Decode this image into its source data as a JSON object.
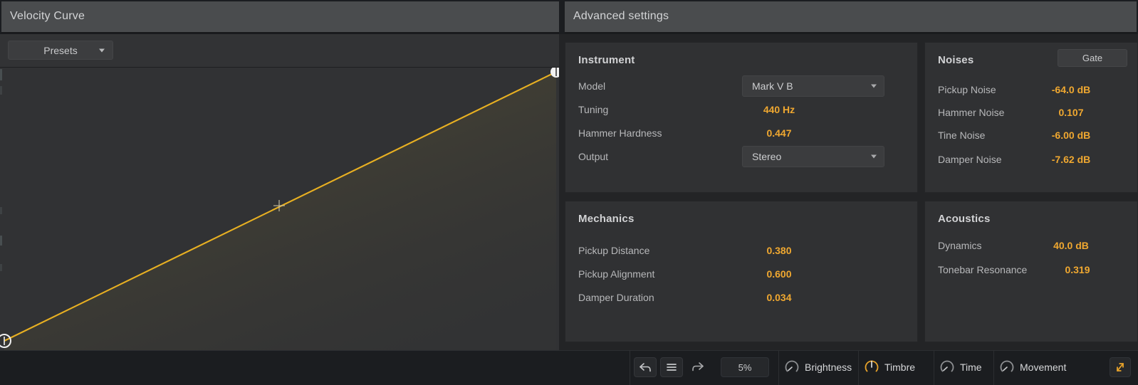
{
  "header": {
    "left_title": "Velocity Curve",
    "right_title": "Advanced settings"
  },
  "velocity_curve": {
    "presets_label": "Presets",
    "presets_caret_icon": "chevron-down-icon",
    "curve_color": "#e8b022",
    "fill_color": "#554c2e",
    "background": "#313234",
    "chart_data": {
      "type": "line",
      "title": "Velocity Curve",
      "xlabel": "",
      "ylabel": "",
      "xlim": [
        0,
        1
      ],
      "ylim": [
        0,
        1
      ],
      "grid": false,
      "series": [
        {
          "name": "velocity",
          "points": [
            [
              0,
              0
            ],
            [
              0.5,
              0.5
            ],
            [
              1,
              1
            ]
          ]
        }
      ],
      "handles": [
        {
          "name": "start-handle",
          "x": 0,
          "y": 0
        },
        {
          "name": "mid-handle",
          "x": 0.5,
          "y": 0.5
        },
        {
          "name": "end-handle",
          "x": 1,
          "y": 1
        }
      ]
    }
  },
  "advanced": {
    "instrument": {
      "title": "Instrument",
      "rows": [
        {
          "label": "Model",
          "value": "Mark V B",
          "type": "select"
        },
        {
          "label": "Tuning",
          "value": "440 Hz",
          "type": "value"
        },
        {
          "label": "Hammer Hardness",
          "value": "0.447",
          "type": "value"
        },
        {
          "label": "Output",
          "value": "Stereo",
          "type": "select"
        }
      ]
    },
    "mechanics": {
      "title": "Mechanics",
      "rows": [
        {
          "label": "Pickup Distance",
          "value": "0.380"
        },
        {
          "label": "Pickup Alignment",
          "value": "0.600"
        },
        {
          "label": "Damper Duration",
          "value": "0.034"
        }
      ]
    },
    "noises": {
      "title": "Noises",
      "gate_label": "Gate",
      "rows": [
        {
          "label": "Pickup Noise",
          "value": "-64.0 dB"
        },
        {
          "label": "Hammer Noise",
          "value": "0.107"
        },
        {
          "label": "Tine Noise",
          "value": "-6.00 dB"
        },
        {
          "label": "Damper Noise",
          "value": "-7.62 dB"
        }
      ]
    },
    "acoustics": {
      "title": "Acoustics",
      "rows": [
        {
          "label": "Dynamics",
          "value": "40.0 dB"
        },
        {
          "label": "Tonebar Resonance",
          "value": "0.319"
        }
      ]
    }
  },
  "bottom_bar": {
    "undo_icon": "undo-arrow-icon",
    "menu_icon": "hamburger-menu-icon",
    "redo_icon": "redo-arrow-icon",
    "percent_value": "5%",
    "expand_icon": "expand-diagonal-icon",
    "knobs": [
      {
        "label": "Brightness",
        "icon": "knob-icon",
        "active": false,
        "angle": -128
      },
      {
        "label": "Timbre",
        "icon": "knob-icon",
        "active": true,
        "angle": -45
      },
      {
        "label": "Time",
        "icon": "knob-icon",
        "active": false,
        "angle": -128
      },
      {
        "label": "Movement",
        "icon": "knob-icon",
        "active": false,
        "angle": -128
      }
    ]
  },
  "colors": {
    "accent": "#f0a830",
    "curve": "#e8b022",
    "panel_bg": "#303133",
    "header_bg": "#4a4c4e",
    "bottom_bg": "#1b1d20"
  }
}
